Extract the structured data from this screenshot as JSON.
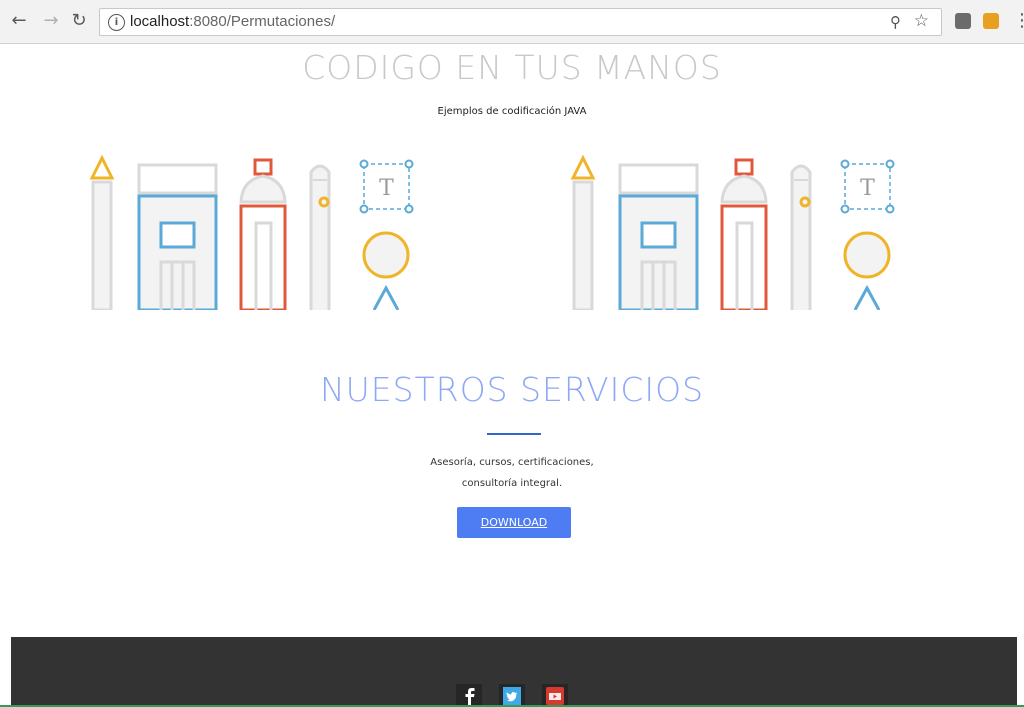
{
  "browser": {
    "url_host": "localhost",
    "url_path": ":8080/Permutaciones/",
    "icons": [
      "back-icon",
      "forward-icon",
      "reload-icon",
      "info-icon",
      "zoom-icon",
      "star-icon",
      "extension-icon",
      "extension-icon",
      "menu-icon"
    ]
  },
  "header": {
    "title": "CODIGO EN TUS MANOS",
    "subtitle": "Ejemplos de codificación JAVA"
  },
  "illustration": {
    "letter": "T",
    "colors": {
      "yellow": "#f0b429",
      "blue": "#5aa9d6",
      "red": "#e0583a",
      "gray": "#d9d9d9"
    }
  },
  "services": {
    "title": "NUESTROS SERVICIOS",
    "description_line1": "Asesoría, cursos, certificaciones,",
    "description_line2": "consultoría integral.",
    "button": "DOWNLOAD"
  },
  "footer": {
    "social": [
      "facebook-icon",
      "twitter-icon",
      "youtube-icon"
    ]
  }
}
